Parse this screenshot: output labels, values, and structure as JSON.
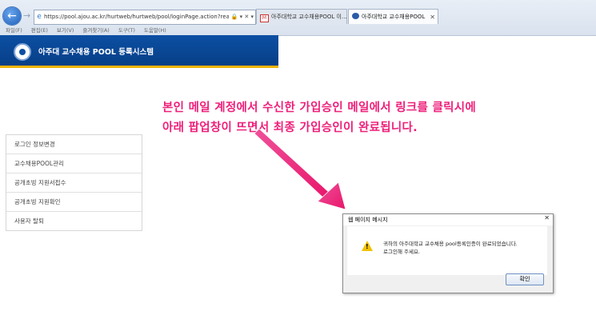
{
  "browser": {
    "address": "https://pool.ajou.ac.kr/hurtweb/hurtweb/pool/loginPage.action?reason",
    "address_tools": "🔒 ▾ ✕ ▾",
    "tabs": [
      {
        "label": "아주대학교 교수채용POOL 이...",
        "icon": "gmail-icon"
      },
      {
        "label": "아주대학교 교수채용POOL",
        "icon": "ajou-icon"
      }
    ],
    "menu": [
      "파일(F)",
      "편집(E)",
      "보기(V)",
      "즐겨찾기(A)",
      "도구(T)",
      "도움말(H)"
    ]
  },
  "site": {
    "title": "아주대 교수채용 POOL 등록시스템"
  },
  "annotation": {
    "line1": "본인 메일 계정에서 수신한 가입승인 메일에서 링크를 클릭시에",
    "line2": "아래 팝업창이 뜨면서 최종 가입승인이 완료됩니다."
  },
  "sidebar": {
    "items": [
      "로그인 정보변경",
      "교수채용POOL관리",
      "공개초빙 지원서접수",
      "공개초빙 지원확인",
      "사용자 탈퇴"
    ]
  },
  "dialog": {
    "title": "웹 페이지 메시지",
    "message_line1": "귀하의 아주대학교 교수채용 pool등록인증이 완료되었습니다.",
    "message_line2": "로그인해 주세요.",
    "ok_label": "확인"
  },
  "colors": {
    "annotation": "#ee1f7a",
    "header_bg": "#0c4fa3",
    "header_stripe": "#f3b300"
  }
}
